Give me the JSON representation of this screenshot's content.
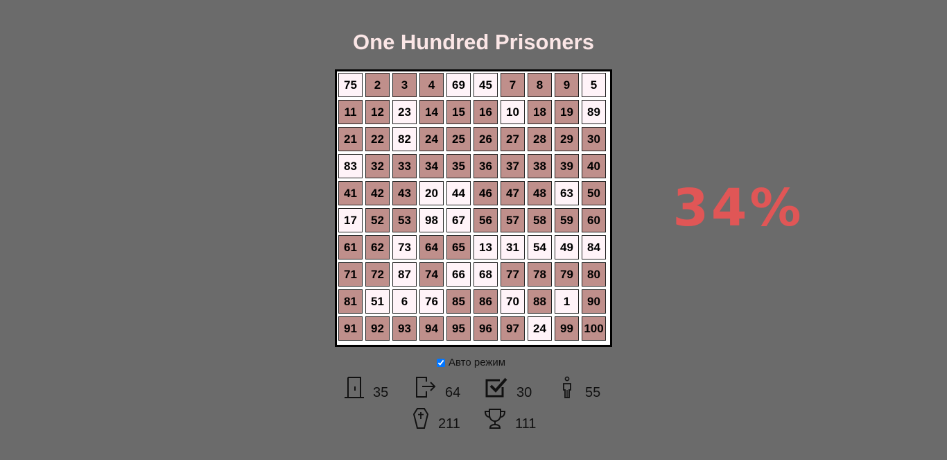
{
  "title": "One Hundred Prisoners",
  "grid": [
    [
      {
        "n": "75",
        "s": "open"
      },
      {
        "n": "2",
        "s": "closed"
      },
      {
        "n": "3",
        "s": "closed"
      },
      {
        "n": "4",
        "s": "closed"
      },
      {
        "n": "69",
        "s": "open"
      },
      {
        "n": "45",
        "s": "open"
      },
      {
        "n": "7",
        "s": "closed"
      },
      {
        "n": "8",
        "s": "closed"
      },
      {
        "n": "9",
        "s": "closed"
      },
      {
        "n": "5",
        "s": "open"
      }
    ],
    [
      {
        "n": "11",
        "s": "closed"
      },
      {
        "n": "12",
        "s": "closed"
      },
      {
        "n": "23",
        "s": "open"
      },
      {
        "n": "14",
        "s": "closed"
      },
      {
        "n": "15",
        "s": "closed"
      },
      {
        "n": "16",
        "s": "closed"
      },
      {
        "n": "10",
        "s": "open"
      },
      {
        "n": "18",
        "s": "closed"
      },
      {
        "n": "19",
        "s": "closed"
      },
      {
        "n": "89",
        "s": "open"
      }
    ],
    [
      {
        "n": "21",
        "s": "closed"
      },
      {
        "n": "22",
        "s": "closed"
      },
      {
        "n": "82",
        "s": "open"
      },
      {
        "n": "24",
        "s": "closed"
      },
      {
        "n": "25",
        "s": "closed"
      },
      {
        "n": "26",
        "s": "closed"
      },
      {
        "n": "27",
        "s": "closed"
      },
      {
        "n": "28",
        "s": "closed"
      },
      {
        "n": "29",
        "s": "closed"
      },
      {
        "n": "30",
        "s": "closed"
      }
    ],
    [
      {
        "n": "83",
        "s": "open"
      },
      {
        "n": "32",
        "s": "closed"
      },
      {
        "n": "33",
        "s": "closed"
      },
      {
        "n": "34",
        "s": "closed"
      },
      {
        "n": "35",
        "s": "closed"
      },
      {
        "n": "36",
        "s": "closed"
      },
      {
        "n": "37",
        "s": "closed"
      },
      {
        "n": "38",
        "s": "closed"
      },
      {
        "n": "39",
        "s": "closed"
      },
      {
        "n": "40",
        "s": "closed"
      }
    ],
    [
      {
        "n": "41",
        "s": "closed"
      },
      {
        "n": "42",
        "s": "closed"
      },
      {
        "n": "43",
        "s": "closed"
      },
      {
        "n": "20",
        "s": "open"
      },
      {
        "n": "44",
        "s": "open"
      },
      {
        "n": "46",
        "s": "closed"
      },
      {
        "n": "47",
        "s": "closed"
      },
      {
        "n": "48",
        "s": "closed"
      },
      {
        "n": "63",
        "s": "open"
      },
      {
        "n": "50",
        "s": "closed"
      }
    ],
    [
      {
        "n": "17",
        "s": "open"
      },
      {
        "n": "52",
        "s": "closed"
      },
      {
        "n": "53",
        "s": "closed"
      },
      {
        "n": "98",
        "s": "open"
      },
      {
        "n": "67",
        "s": "open"
      },
      {
        "n": "56",
        "s": "closed"
      },
      {
        "n": "57",
        "s": "closed"
      },
      {
        "n": "58",
        "s": "closed"
      },
      {
        "n": "59",
        "s": "closed"
      },
      {
        "n": "60",
        "s": "closed"
      }
    ],
    [
      {
        "n": "61",
        "s": "closed"
      },
      {
        "n": "62",
        "s": "closed"
      },
      {
        "n": "73",
        "s": "open"
      },
      {
        "n": "64",
        "s": "closed"
      },
      {
        "n": "65",
        "s": "closed"
      },
      {
        "n": "13",
        "s": "open"
      },
      {
        "n": "31",
        "s": "open"
      },
      {
        "n": "54",
        "s": "open"
      },
      {
        "n": "49",
        "s": "open"
      },
      {
        "n": "84",
        "s": "open"
      }
    ],
    [
      {
        "n": "71",
        "s": "closed"
      },
      {
        "n": "72",
        "s": "closed"
      },
      {
        "n": "87",
        "s": "open"
      },
      {
        "n": "74",
        "s": "closed"
      },
      {
        "n": "66",
        "s": "open"
      },
      {
        "n": "68",
        "s": "open"
      },
      {
        "n": "77",
        "s": "closed"
      },
      {
        "n": "78",
        "s": "closed"
      },
      {
        "n": "79",
        "s": "closed"
      },
      {
        "n": "80",
        "s": "closed"
      }
    ],
    [
      {
        "n": "81",
        "s": "closed"
      },
      {
        "n": "51",
        "s": "open"
      },
      {
        "n": "6",
        "s": "open"
      },
      {
        "n": "76",
        "s": "open"
      },
      {
        "n": "85",
        "s": "closed"
      },
      {
        "n": "86",
        "s": "closed"
      },
      {
        "n": "70",
        "s": "open"
      },
      {
        "n": "88",
        "s": "closed"
      },
      {
        "n": "1",
        "s": "open"
      },
      {
        "n": "90",
        "s": "closed"
      }
    ],
    [
      {
        "n": "91",
        "s": "closed"
      },
      {
        "n": "92",
        "s": "closed"
      },
      {
        "n": "93",
        "s": "closed"
      },
      {
        "n": "94",
        "s": "closed"
      },
      {
        "n": "95",
        "s": "closed"
      },
      {
        "n": "96",
        "s": "closed"
      },
      {
        "n": "97",
        "s": "closed"
      },
      {
        "n": "24",
        "s": "open"
      },
      {
        "n": "99",
        "s": "closed"
      },
      {
        "n": "100",
        "s": "closed"
      }
    ]
  ],
  "percent": "34%",
  "auto_mode": {
    "label": "Авто режим",
    "checked": true
  },
  "stats": {
    "door": {
      "icon": "door-icon",
      "value": "35"
    },
    "exit": {
      "icon": "exit-icon",
      "value": "64"
    },
    "check": {
      "icon": "check-icon",
      "value": "30"
    },
    "person": {
      "icon": "person-icon",
      "value": "55"
    },
    "coffin": {
      "icon": "coffin-icon",
      "value": "211"
    },
    "trophy": {
      "icon": "trophy-icon",
      "value": "111"
    }
  },
  "colors": {
    "background": "#6b6b6b",
    "title": "#fbe6e6",
    "closed_box": "#bf8f8b",
    "open_box": "#fff3f8",
    "percent": "#e05656"
  }
}
